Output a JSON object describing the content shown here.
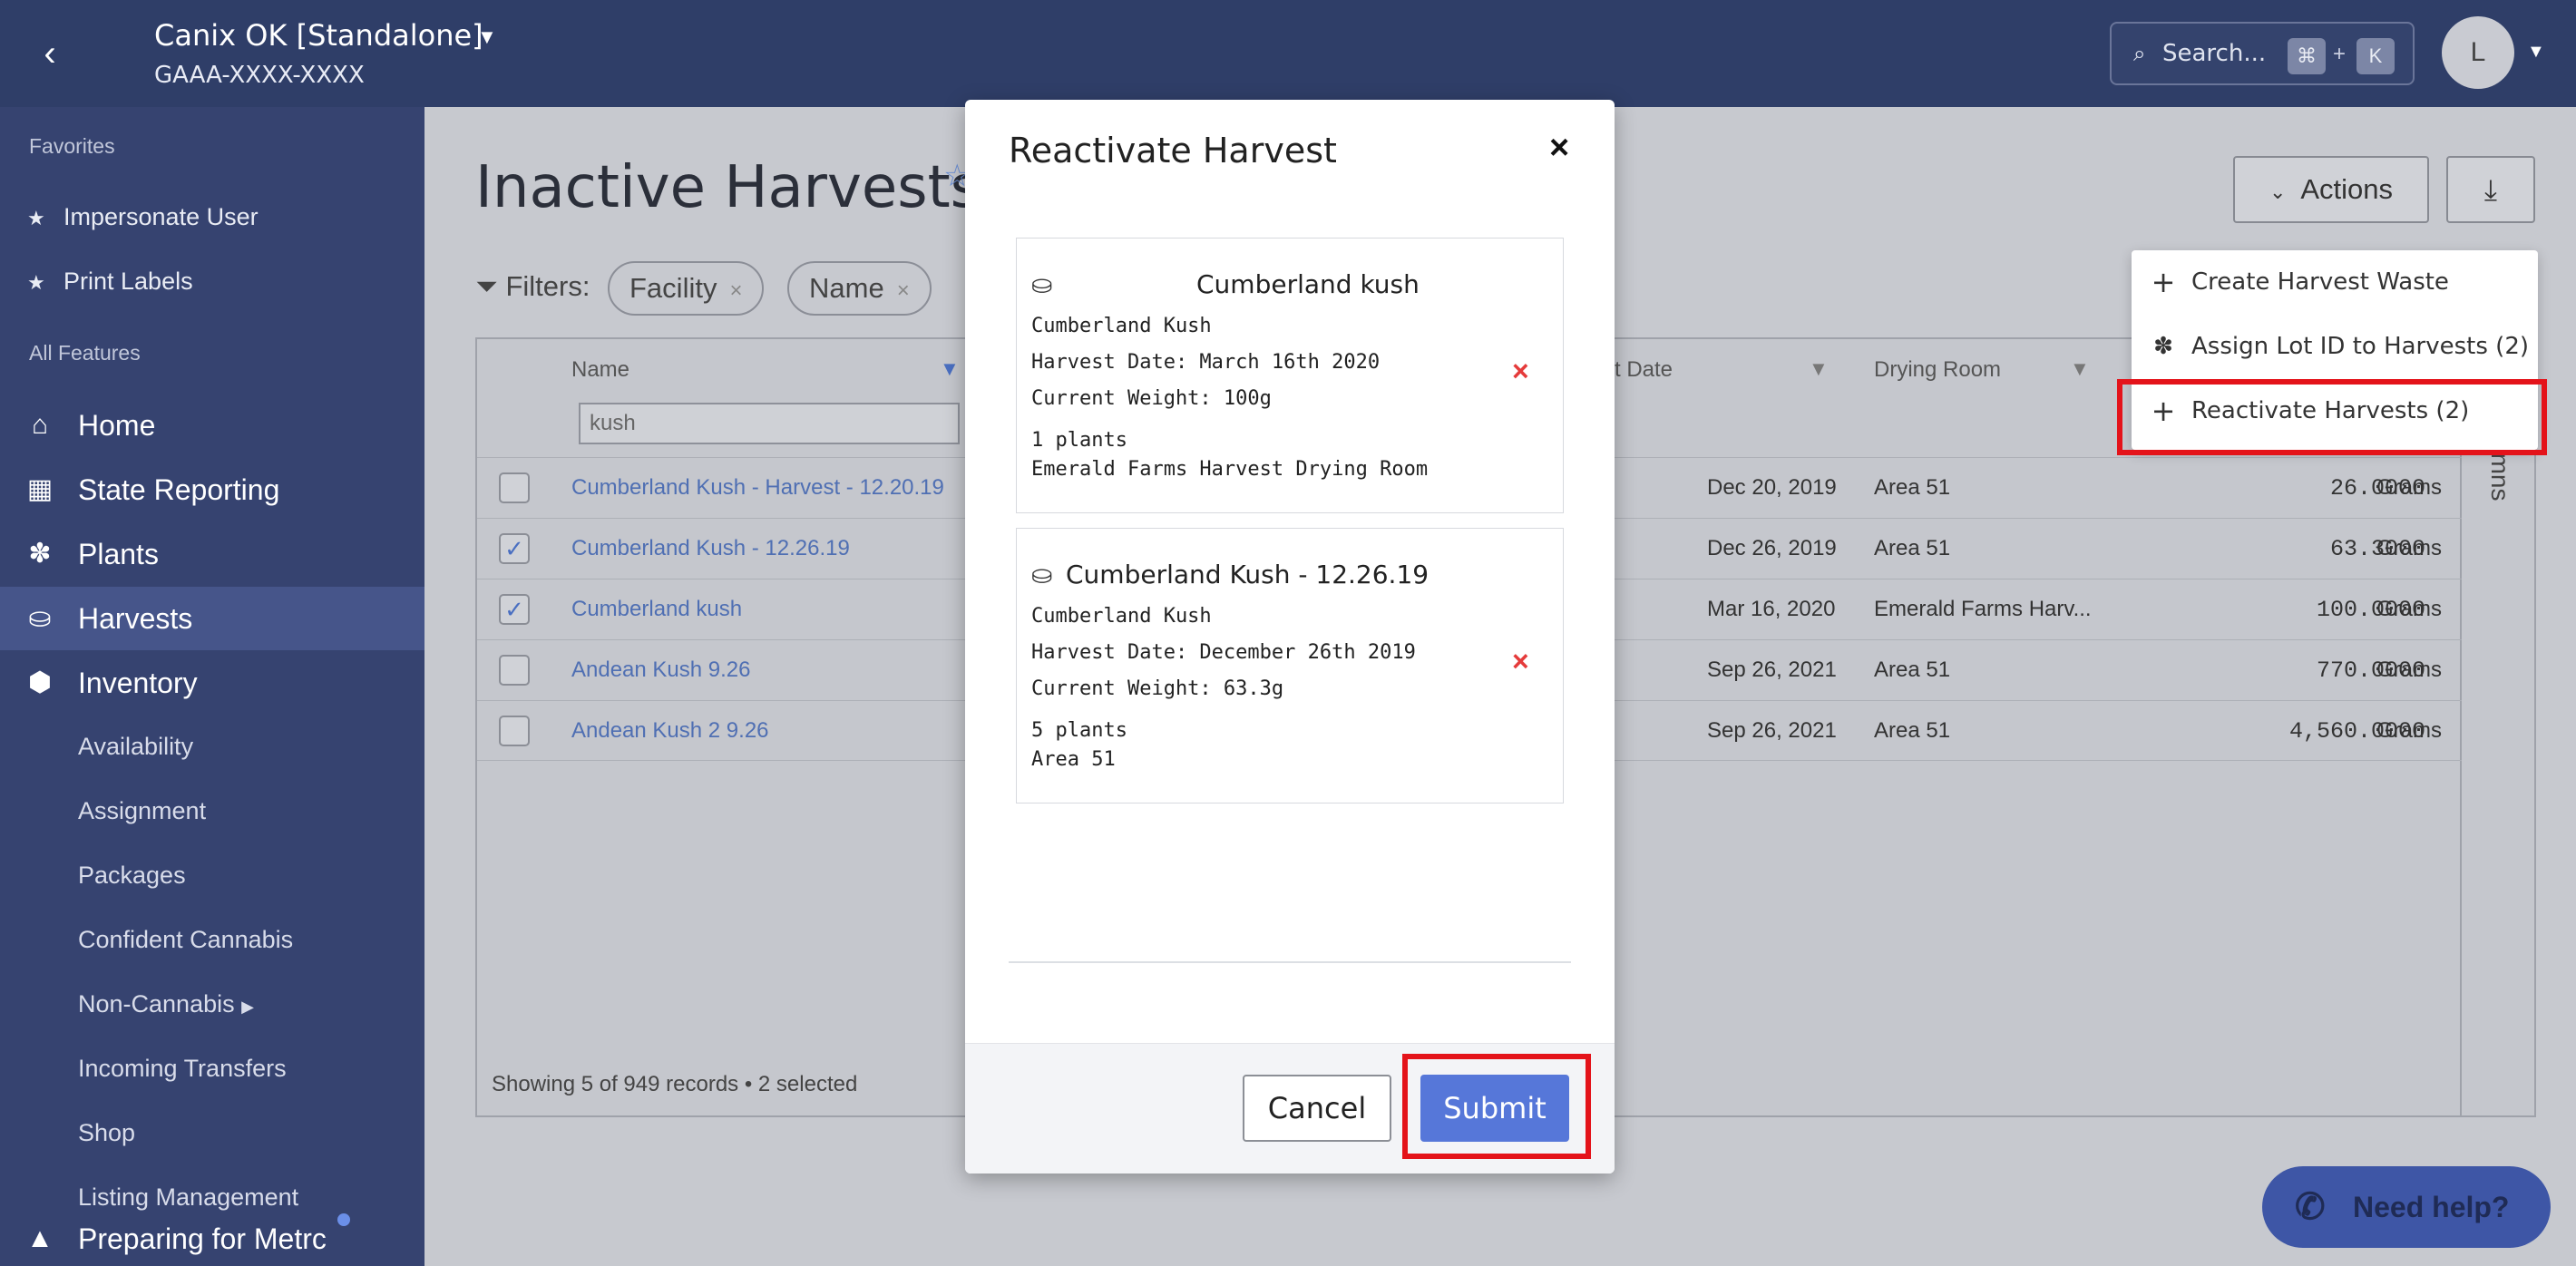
{
  "header": {
    "org_name": "Canix OK [Standalone]",
    "org_id": "GAAA-XXXX-XXXX",
    "search_placeholder": "Search...",
    "shortcut_cmd": "⌘",
    "shortcut_plus": "+",
    "shortcut_key": "K",
    "avatar_initial": "L"
  },
  "sidebar": {
    "favorites_label": "Favorites",
    "favorites": [
      "Impersonate User",
      "Print Labels"
    ],
    "all_features_label": "All Features",
    "main_items": [
      {
        "label": "Home",
        "icon": "home-icon"
      },
      {
        "label": "State Reporting",
        "icon": "calendar-icon"
      },
      {
        "label": "Plants",
        "icon": "leaf-icon"
      },
      {
        "label": "Harvests",
        "icon": "harvest-icon"
      },
      {
        "label": "Inventory",
        "icon": "box-icon"
      }
    ],
    "sub_items": [
      "Availability",
      "Assignment",
      "Packages",
      "Confident Cannabis",
      "Non-Cannabis",
      "Incoming Transfers",
      "Shop",
      "Listing Management"
    ],
    "bottom_item": "Preparing for Metrc"
  },
  "page": {
    "title": "Inactive Harvests",
    "actions_label": "Actions",
    "filters_label": "Filters:",
    "filter_chips": [
      "Facility",
      "Name"
    ]
  },
  "table": {
    "headers": {
      "name": "Name",
      "date": "t Date",
      "drying_room": "Drying Room"
    },
    "name_filter_value": "kush",
    "rows": [
      {
        "name": "Cumberland Kush - Harvest - 12.20.19",
        "date": "Dec 20, 2019",
        "room": "Area 51",
        "weight": "26.0000",
        "unit": "Grams",
        "checked": false
      },
      {
        "name": "Cumberland Kush - 12.26.19",
        "date": "Dec 26, 2019",
        "room": "Area 51",
        "weight": "63.3000",
        "unit": "Grams",
        "checked": true
      },
      {
        "name": "Cumberland kush",
        "date": "Mar 16, 2020",
        "room": "Emerald Farms Harv...",
        "weight": "100.0000",
        "unit": "Grams",
        "checked": true
      },
      {
        "name": "Andean Kush 9.26",
        "date": "Sep 26, 2021",
        "room": "Area 51",
        "weight": "770.0000",
        "unit": "Grams",
        "checked": false
      },
      {
        "name": "Andean Kush 2 9.26",
        "date": "Sep 26, 2021",
        "room": "Area 51",
        "weight": "4,560.0000",
        "unit": "Grams",
        "checked": false
      }
    ],
    "footer": "Showing 5 of 949 records • 2 selected",
    "columns_label": "umns"
  },
  "actions_menu": [
    {
      "label": "Create Harvest Waste",
      "icon": "plus-icon"
    },
    {
      "label": "Assign Lot ID to Harvests (2)",
      "icon": "leaf-icon"
    },
    {
      "label": "Reactivate Harvests (2)",
      "icon": "plus-icon"
    }
  ],
  "modal": {
    "title": "Reactivate Harvest",
    "cards": [
      {
        "title": "Cumberland kush",
        "strain": "Cumberland Kush",
        "harvest_date": "Harvest Date: March 16th 2020",
        "weight": "Current Weight: 100g",
        "plants": "1 plants",
        "room": "Emerald Farms Harvest Drying Room"
      },
      {
        "title": "Cumberland Kush - 12.26.19",
        "strain": "Cumberland Kush",
        "harvest_date": "Harvest Date: December 26th 2019",
        "weight": "Current Weight: 63.3g",
        "plants": "5 plants",
        "room": "Area 51"
      }
    ],
    "cancel_label": "Cancel",
    "submit_label": "Submit"
  },
  "help_label": "Need help?",
  "colors": {
    "topbar": "#2f3e68",
    "sidebar": "#364370",
    "primary": "#5677d9",
    "highlight": "#e4131a",
    "remove": "#e53b3b"
  }
}
